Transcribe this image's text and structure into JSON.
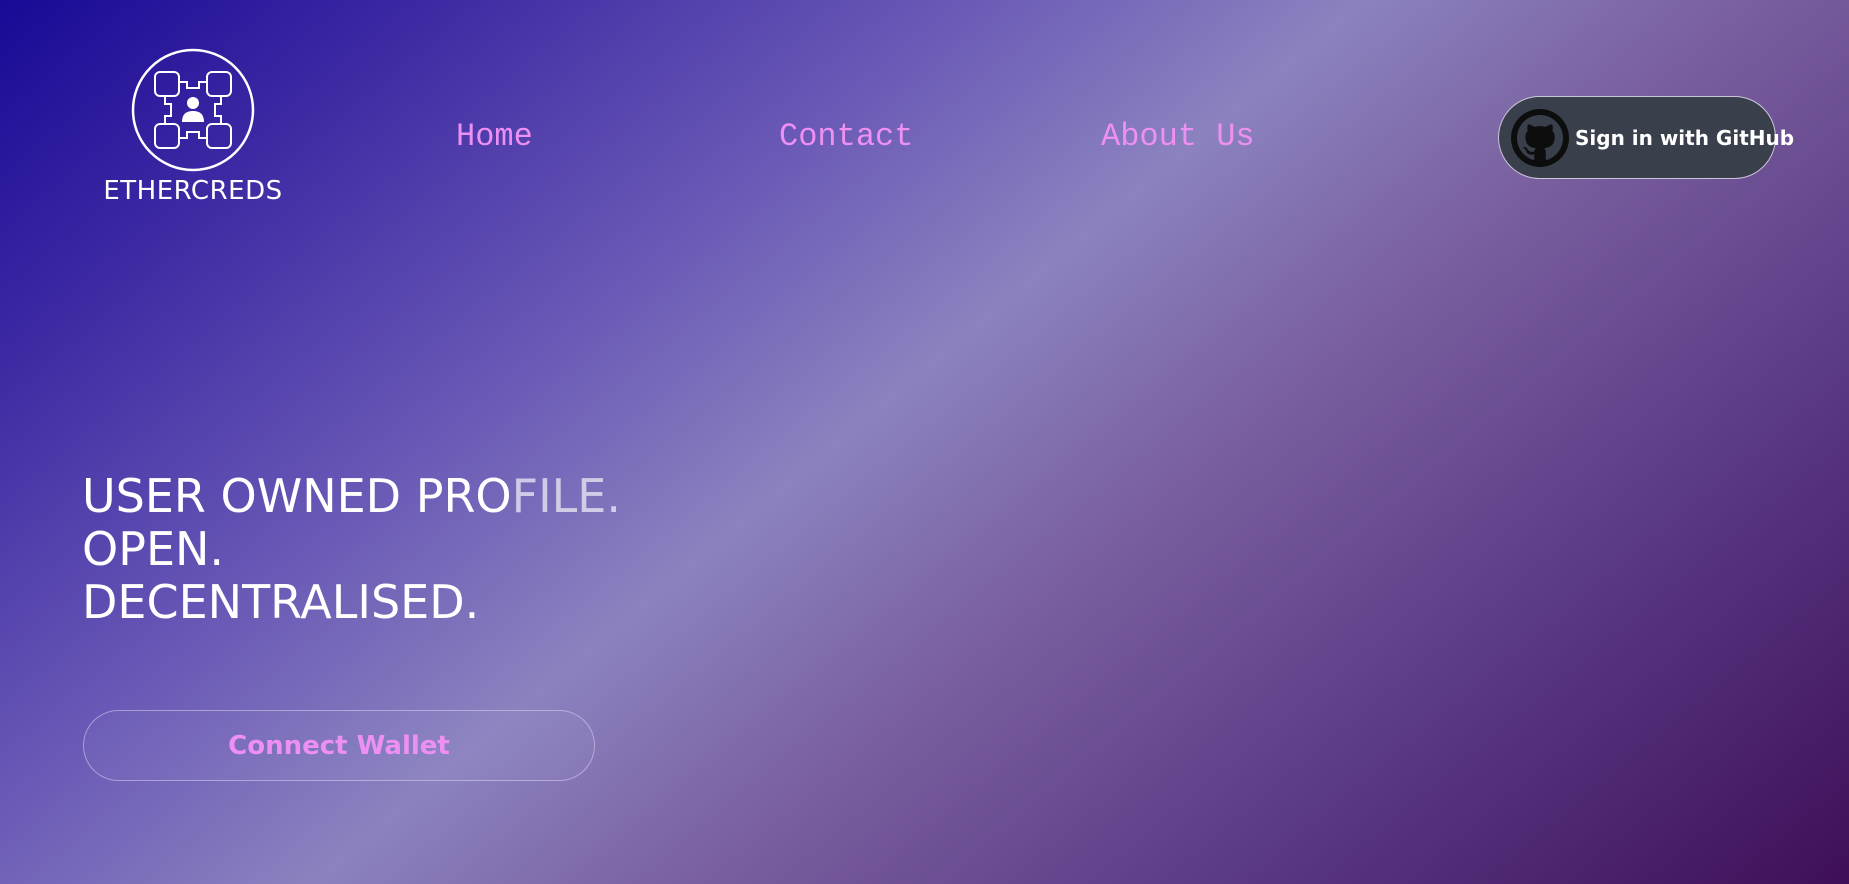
{
  "brand": {
    "name": "ETHERCREDS",
    "logo_icon": "blockchain-user-network-icon"
  },
  "nav": {
    "items": [
      {
        "label": "Home"
      },
      {
        "label": "Contact"
      },
      {
        "label": "About Us"
      }
    ]
  },
  "auth": {
    "github_label": "Sign in with GitHub",
    "github_icon": "github-octocat-icon"
  },
  "hero": {
    "line1_main": "USER OWNED PRO",
    "line1_faded": "FILE.",
    "line2": "OPEN.",
    "line3": "DECENTRALISED."
  },
  "cta": {
    "connect_label": "Connect Wallet"
  },
  "colors": {
    "nav_link": "#ee8ff3",
    "github_button_bg": "#39404c",
    "gradient_start": "#180a96",
    "gradient_mid": "#8b82bf",
    "gradient_end": "#3e0f58"
  }
}
